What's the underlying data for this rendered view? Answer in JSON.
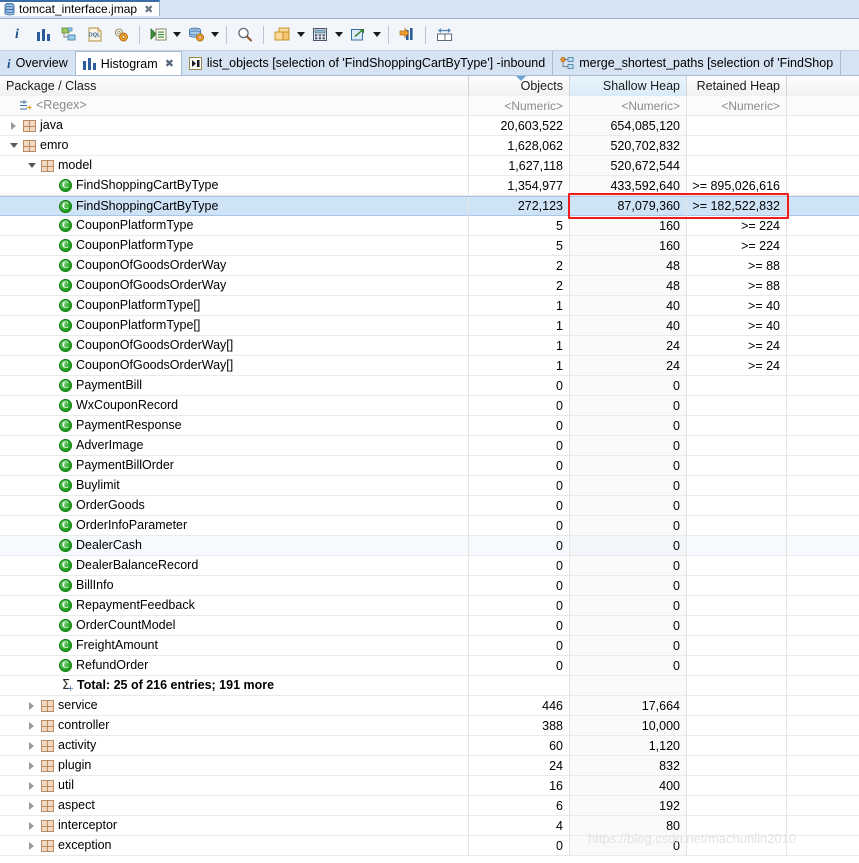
{
  "window": {
    "editor_tab": {
      "title": "tomcat_interface.jmap",
      "close": "✖",
      "icon": "jmap-file-icon"
    }
  },
  "toolbar": {
    "buttons": [
      {
        "name": "inspector-icon",
        "glyph": "i"
      },
      {
        "name": "histogram-icon",
        "glyph": "bars"
      },
      {
        "name": "dominator-tree-icon",
        "glyph": "tree"
      },
      {
        "name": "oql-icon",
        "glyph": "OQL"
      },
      {
        "name": "calculate-retained-size-icon",
        "glyph": "gears"
      },
      {
        "name": "run-expert-system-test-icon",
        "glyph": "run-list",
        "has_menu": true
      },
      {
        "name": "query-browser-icon",
        "glyph": "db-gear",
        "has_menu": true
      },
      {
        "name": "find-icon",
        "glyph": "magnifier"
      },
      {
        "name": "group-by-icon",
        "glyph": "windows",
        "has_menu": true
      },
      {
        "name": "calculator-icon",
        "glyph": "calculator",
        "has_menu": true
      },
      {
        "name": "export-icon",
        "glyph": "export-arrow",
        "has_menu": true
      },
      {
        "name": "compare-icon",
        "glyph": "bars-compare"
      },
      {
        "name": "layout-icon",
        "glyph": "split-layout"
      }
    ]
  },
  "view_tabs": [
    {
      "label": "Overview",
      "icon": "overview-icon",
      "active": false,
      "closable": false
    },
    {
      "label": "Histogram",
      "icon": "histogram-icon",
      "active": true,
      "closable": true,
      "close": "✖"
    },
    {
      "label": "list_objects [selection of 'FindShoppingCartByType'] -inbound",
      "icon": "list-objects-icon",
      "active": false,
      "closable": false
    },
    {
      "label": "merge_shortest_paths [selection of 'FindShop",
      "icon": "merge-paths-icon",
      "active": false,
      "closable": false
    }
  ],
  "table": {
    "columns": [
      {
        "key": "name",
        "label": "Package / Class",
        "align": "left",
        "sorted": false
      },
      {
        "key": "objects",
        "label": "Objects",
        "align": "right",
        "sorted": false
      },
      {
        "key": "shallow",
        "label": "Shallow Heap",
        "align": "right",
        "sorted": true
      },
      {
        "key": "retained",
        "label": "Retained Heap",
        "align": "right",
        "sorted": false
      }
    ],
    "filter_row": {
      "icon": "regex-filter-icon",
      "name": "<Regex>",
      "objects": "<Numeric>",
      "shallow": "<Numeric>",
      "retained": "<Numeric>"
    },
    "rows": [
      {
        "icon": "package-icon",
        "twisty": "closed",
        "indent": 0,
        "name": "java",
        "objects": "20,603,522",
        "shallow": "654,085,120",
        "retained": ""
      },
      {
        "icon": "package-icon",
        "twisty": "open",
        "indent": 0,
        "name": "emro",
        "objects": "1,628,062",
        "shallow": "520,702,832",
        "retained": ""
      },
      {
        "icon": "package-icon",
        "twisty": "open",
        "indent": 1,
        "name": "model",
        "objects": "1,627,118",
        "shallow": "520,672,544",
        "retained": ""
      },
      {
        "icon": "class-icon",
        "twisty": "none",
        "indent": 2,
        "name": "FindShoppingCartByType",
        "objects": "1,354,977",
        "shallow": "433,592,640",
        "retained": ">= 895,026,616"
      },
      {
        "icon": "class-icon",
        "twisty": "none",
        "indent": 2,
        "name": "FindShoppingCartByType",
        "objects": "272,123",
        "shallow": "87,079,360",
        "retained": ">= 182,522,832",
        "selected": true
      },
      {
        "icon": "class-icon",
        "twisty": "none",
        "indent": 2,
        "name": "CouponPlatformType",
        "objects": "5",
        "shallow": "160",
        "retained": ">= 224"
      },
      {
        "icon": "class-icon",
        "twisty": "none",
        "indent": 2,
        "name": "CouponPlatformType",
        "objects": "5",
        "shallow": "160",
        "retained": ">= 224"
      },
      {
        "icon": "class-icon",
        "twisty": "none",
        "indent": 2,
        "name": "CouponOfGoodsOrderWay",
        "objects": "2",
        "shallow": "48",
        "retained": ">= 88"
      },
      {
        "icon": "class-icon",
        "twisty": "none",
        "indent": 2,
        "name": "CouponOfGoodsOrderWay",
        "objects": "2",
        "shallow": "48",
        "retained": ">= 88"
      },
      {
        "icon": "class-icon",
        "twisty": "none",
        "indent": 2,
        "name": "CouponPlatformType[]",
        "objects": "1",
        "shallow": "40",
        "retained": ">= 40"
      },
      {
        "icon": "class-icon",
        "twisty": "none",
        "indent": 2,
        "name": "CouponPlatformType[]",
        "objects": "1",
        "shallow": "40",
        "retained": ">= 40"
      },
      {
        "icon": "class-icon",
        "twisty": "none",
        "indent": 2,
        "name": "CouponOfGoodsOrderWay[]",
        "objects": "1",
        "shallow": "24",
        "retained": ">= 24"
      },
      {
        "icon": "class-icon",
        "twisty": "none",
        "indent": 2,
        "name": "CouponOfGoodsOrderWay[]",
        "objects": "1",
        "shallow": "24",
        "retained": ">= 24"
      },
      {
        "icon": "class-icon",
        "twisty": "none",
        "indent": 2,
        "name": "PaymentBill",
        "objects": "0",
        "shallow": "0",
        "retained": ""
      },
      {
        "icon": "class-icon",
        "twisty": "none",
        "indent": 2,
        "name": "WxCouponRecord",
        "objects": "0",
        "shallow": "0",
        "retained": ""
      },
      {
        "icon": "class-icon",
        "twisty": "none",
        "indent": 2,
        "name": "PaymentResponse",
        "objects": "0",
        "shallow": "0",
        "retained": ""
      },
      {
        "icon": "class-icon",
        "twisty": "none",
        "indent": 2,
        "name": "AdverImage",
        "objects": "0",
        "shallow": "0",
        "retained": ""
      },
      {
        "icon": "class-icon",
        "twisty": "none",
        "indent": 2,
        "name": "PaymentBillOrder",
        "objects": "0",
        "shallow": "0",
        "retained": ""
      },
      {
        "icon": "class-icon",
        "twisty": "none",
        "indent": 2,
        "name": "Buylimit",
        "objects": "0",
        "shallow": "0",
        "retained": ""
      },
      {
        "icon": "class-icon",
        "twisty": "none",
        "indent": 2,
        "name": "OrderGoods",
        "objects": "0",
        "shallow": "0",
        "retained": ""
      },
      {
        "icon": "class-icon",
        "twisty": "none",
        "indent": 2,
        "name": "OrderInfoParameter",
        "objects": "0",
        "shallow": "0",
        "retained": ""
      },
      {
        "icon": "class-icon",
        "twisty": "none",
        "indent": 2,
        "name": "DealerCash",
        "objects": "0",
        "shallow": "0",
        "retained": "",
        "alt": true
      },
      {
        "icon": "class-icon",
        "twisty": "none",
        "indent": 2,
        "name": "DealerBalanceRecord",
        "objects": "0",
        "shallow": "0",
        "retained": ""
      },
      {
        "icon": "class-icon",
        "twisty": "none",
        "indent": 2,
        "name": "BillInfo",
        "objects": "0",
        "shallow": "0",
        "retained": ""
      },
      {
        "icon": "class-icon",
        "twisty": "none",
        "indent": 2,
        "name": "RepaymentFeedback",
        "objects": "0",
        "shallow": "0",
        "retained": ""
      },
      {
        "icon": "class-icon",
        "twisty": "none",
        "indent": 2,
        "name": "OrderCountModel",
        "objects": "0",
        "shallow": "0",
        "retained": ""
      },
      {
        "icon": "class-icon",
        "twisty": "none",
        "indent": 2,
        "name": "FreightAmount",
        "objects": "0",
        "shallow": "0",
        "retained": ""
      },
      {
        "icon": "class-icon",
        "twisty": "none",
        "indent": 2,
        "name": "RefundOrder",
        "objects": "0",
        "shallow": "0",
        "retained": ""
      },
      {
        "icon": "total-icon",
        "twisty": "none",
        "indent": 2,
        "name": "Total: 25 of 216 entries; 191 more",
        "objects": "",
        "shallow": "",
        "retained": "",
        "bold": true
      },
      {
        "icon": "package-icon",
        "twisty": "closed",
        "indent": 1,
        "name": "service",
        "objects": "446",
        "shallow": "17,664",
        "retained": ""
      },
      {
        "icon": "package-icon",
        "twisty": "closed",
        "indent": 1,
        "name": "controller",
        "objects": "388",
        "shallow": "10,000",
        "retained": ""
      },
      {
        "icon": "package-icon",
        "twisty": "closed",
        "indent": 1,
        "name": "activity",
        "objects": "60",
        "shallow": "1,120",
        "retained": ""
      },
      {
        "icon": "package-icon",
        "twisty": "closed",
        "indent": 1,
        "name": "plugin",
        "objects": "24",
        "shallow": "832",
        "retained": ""
      },
      {
        "icon": "package-icon",
        "twisty": "closed",
        "indent": 1,
        "name": "util",
        "objects": "16",
        "shallow": "400",
        "retained": ""
      },
      {
        "icon": "package-icon",
        "twisty": "closed",
        "indent": 1,
        "name": "aspect",
        "objects": "6",
        "shallow": "192",
        "retained": ""
      },
      {
        "icon": "package-icon",
        "twisty": "closed",
        "indent": 1,
        "name": "interceptor",
        "objects": "4",
        "shallow": "80",
        "retained": ""
      },
      {
        "icon": "package-icon",
        "twisty": "closed",
        "indent": 1,
        "name": "exception",
        "objects": "0",
        "shallow": "0",
        "retained": ""
      }
    ]
  },
  "annotation": {
    "type": "rectangle",
    "color": "#f01b1b",
    "covers": "shallow and retained heap cells of selected FindShoppingCartByType row"
  },
  "watermark": {
    "text": "https://blog.csdn.net/machunlin2010"
  },
  "colors": {
    "selection": "#cfe3f7",
    "tab_strip": "#d6e3f2",
    "toolbar": "#f2f6fb",
    "annotation": "#f01b1b",
    "class_icon": "#189d18",
    "package_icon": "#f2d9c2"
  }
}
